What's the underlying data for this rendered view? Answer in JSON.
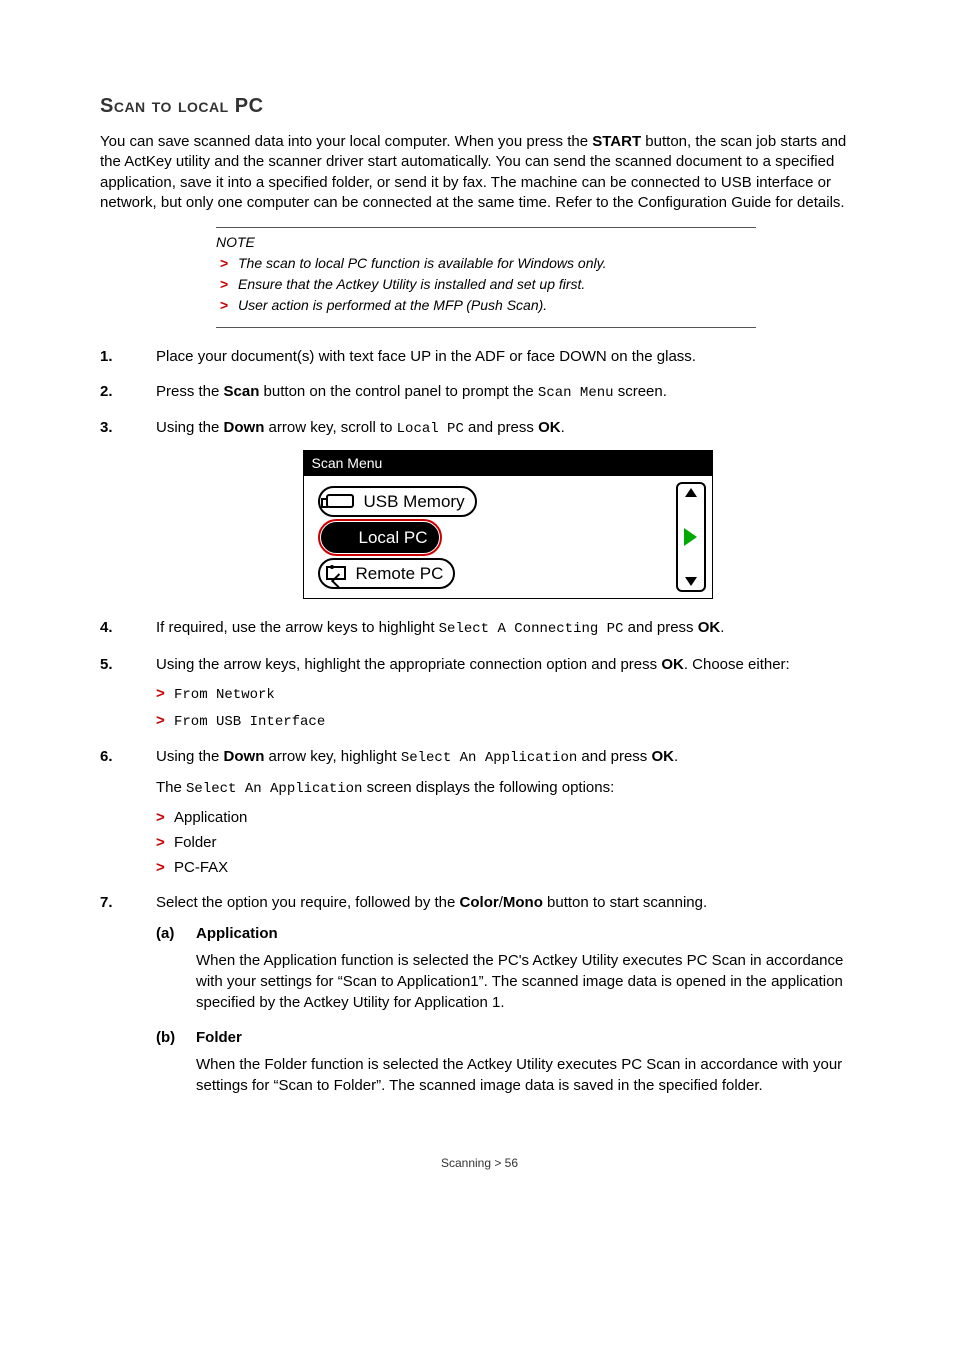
{
  "section_title": "Scan to local PC",
  "intro": "You can save scanned data into your local computer. When you press the START button, the scan job starts and the ActKey utility and the scanner driver start automatically. You can send the scanned document to a specified application, save it into a specified folder, or send it by fax. The machine can be connected to USB interface or network, but only one computer can be connected at the same time. Refer to the Configuration Guide for details.",
  "intro_bold": "START",
  "note": {
    "title": "NOTE",
    "items": [
      "The scan to local PC function is available for Windows only.",
      "Ensure that the Actkey Utility is installed and set up first.",
      "User action is performed at the MFP (Push Scan)."
    ]
  },
  "steps": {
    "s1": "Place your document(s) with text face UP in the ADF or face DOWN on the glass.",
    "s2_a": "Press the ",
    "s2_b": "Scan",
    "s2_c": " button on the control panel to prompt the ",
    "s2_d": "Scan Menu",
    "s2_e": " screen.",
    "s3_a": "Using the ",
    "s3_b": "Down",
    "s3_c": " arrow key, scroll to ",
    "s3_d": "Local PC",
    "s3_e": " and press ",
    "s3_f": "OK",
    "s3_g": ".",
    "s4_a": "If required, use the arrow keys to highlight ",
    "s4_b": "Select A Connecting PC",
    "s4_c": " and press ",
    "s4_d": "OK",
    "s4_e": ".",
    "s5_a": "Using the arrow keys, highlight the appropriate connection option and press ",
    "s5_b": "OK",
    "s5_c": ". Choose either:",
    "s5_opts": [
      "From Network",
      "From USB Interface"
    ],
    "s6_a": "Using the ",
    "s6_b": "Down",
    "s6_c": " arrow key, highlight ",
    "s6_d": "Select An Application",
    "s6_e": " and press ",
    "s6_f": "OK",
    "s6_g": ".",
    "s6_line2_a": "The ",
    "s6_line2_b": "Select An Application",
    "s6_line2_c": " screen displays the following options:",
    "s6_opts": [
      "Application",
      "Folder",
      "PC-FAX"
    ],
    "s7_a": "Select the option you require, followed by the ",
    "s7_b": "Color",
    "s7_c": "/",
    "s7_d": "Mono",
    "s7_e": " button to start scanning.",
    "s7_sub": [
      {
        "lbl": "(a)",
        "hd": "Application",
        "desc": "When the Application function is selected the PC's Actkey Utility executes PC Scan in accordance with your settings for “Scan to Application1”. The scanned image data is opened in the application specified by the Actkey Utility for Application 1."
      },
      {
        "lbl": "(b)",
        "hd": "Folder",
        "desc": "When the Folder function is selected the Actkey Utility executes PC Scan in accordance with your settings for “Scan to Folder”. The scanned image data is saved in the specified folder."
      }
    ]
  },
  "scan_menu": {
    "title": "Scan Menu",
    "items": [
      "USB Memory",
      "Local PC",
      "Remote PC"
    ]
  },
  "footer": "Scanning > 56"
}
